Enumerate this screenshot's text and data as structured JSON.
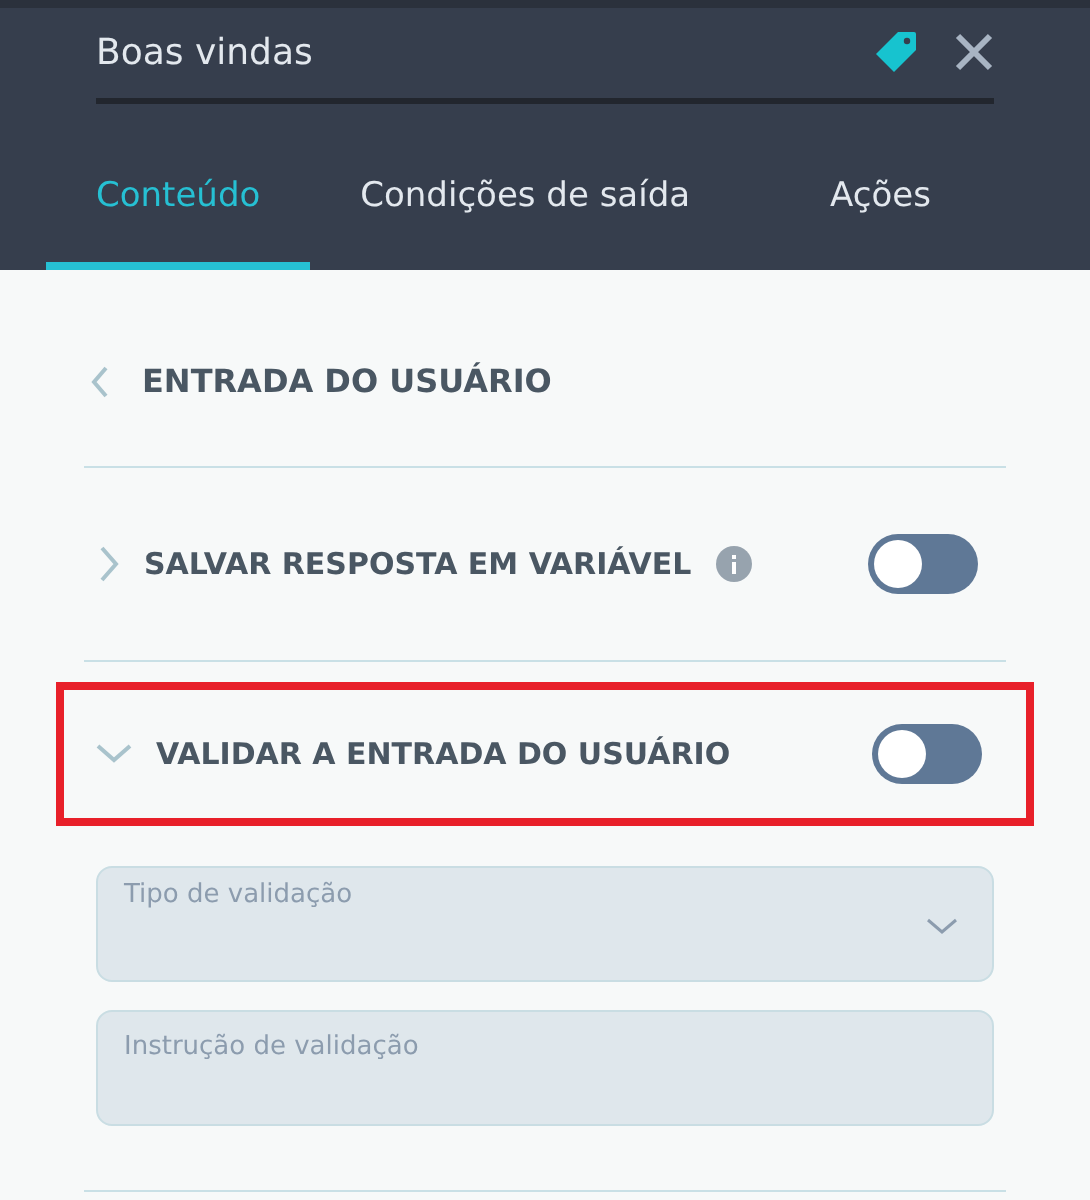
{
  "header": {
    "title": "Boas vindas"
  },
  "tabs": [
    {
      "label": "Conteúdo",
      "selected": true
    },
    {
      "label": "Condições de saída",
      "selected": false
    },
    {
      "label": "Ações",
      "selected": false
    }
  ],
  "back": {
    "label": "ENTRADA DO USUÁRIO"
  },
  "settings": [
    {
      "label": "SALVAR RESPOSTA EM VARIÁVEL",
      "info": true,
      "expanded": false,
      "on": false,
      "highlighted": false
    },
    {
      "label": "VALIDAR A ENTRADA DO USUÁRIO",
      "info": false,
      "expanded": true,
      "on": false,
      "highlighted": true
    }
  ],
  "fields": [
    {
      "kind": "select",
      "placeholder": "Tipo de validação"
    },
    {
      "kind": "text",
      "placeholder": "Instrução de validação"
    }
  ]
}
